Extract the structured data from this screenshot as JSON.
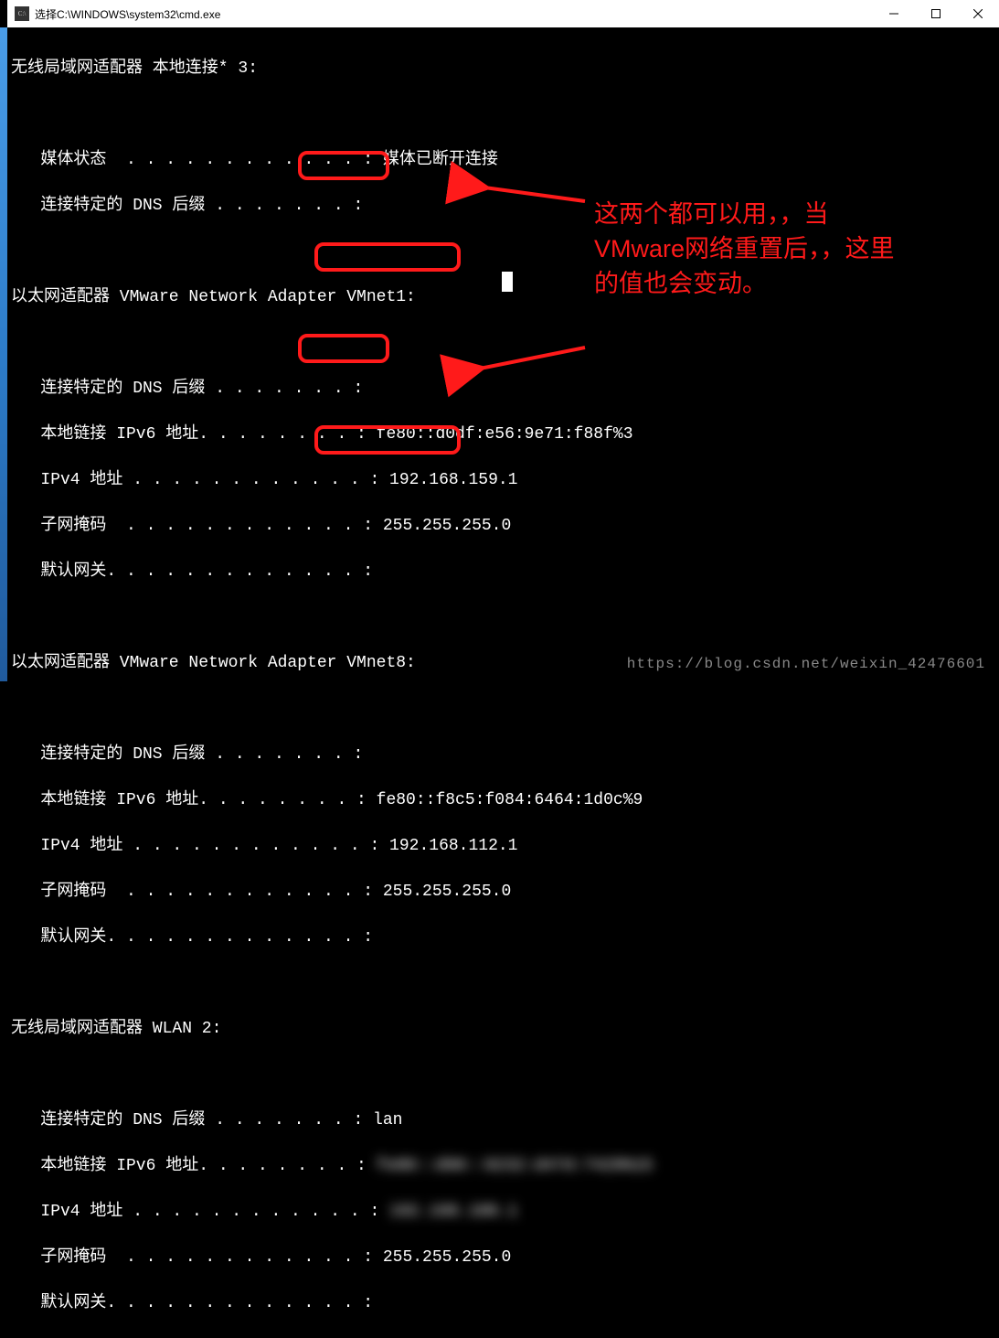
{
  "titlebar": {
    "title": "选择C:\\WINDOWS\\system32\\cmd.exe",
    "icon_label": "cmd"
  },
  "console": {
    "l1": "无线局域网适配器 本地连接* 3:",
    "l2": "",
    "l3": "   媒体状态  . . . . . . . . . . . . : 媒体已断开连接",
    "l4": "   连接特定的 DNS 后缀 . . . . . . . :",
    "l5": "",
    "l6": "以太网适配器 VMware Network Adapter VMnet1:",
    "l7": "",
    "l8": "   连接特定的 DNS 后缀 . . . . . . . :",
    "l9": "   本地链接 IPv6 地址. . . . . . . . : fe80::d0df:e56:9e71:f88f%3",
    "l10": "   IPv4 地址 . . . . . . . . . . . . : 192.168.159.1",
    "l11": "   子网掩码  . . . . . . . . . . . . : 255.255.255.0",
    "l12": "   默认网关. . . . . . . . . . . . . :",
    "l13": "",
    "l14": "以太网适配器 VMware Network Adapter VMnet8:",
    "l15": "",
    "l16": "   连接特定的 DNS 后缀 . . . . . . . :",
    "l17": "   本地链接 IPv6 地址. . . . . . . . : fe80::f8c5:f084:6464:1d0c%9",
    "l18": "   IPv4 地址 . . . . . . . . . . . . : 192.168.112.1",
    "l19": "   子网掩码  . . . . . . . . . . . . : 255.255.255.0",
    "l20": "   默认网关. . . . . . . . . . . . . :",
    "l21": "",
    "l22": "无线局域网适配器 WLAN 2:",
    "l23": "",
    "l24": "   连接特定的 DNS 后缀 . . . . . . . : lan",
    "l25a": "   本地链接 IPv6 地址. . . . . . . . : ",
    "l25b": "fe80::d90::9232:d47d:7429%15",
    "l26a": "   IPv4 地址 . . . . . . . . . . . . : ",
    "l26b": "192.168.100.1",
    "l27": "   子网掩码  . . . . . . . . . . . . : 255.255.255.0",
    "l28": "   默认网关. . . . . . . . . . . . . :"
  },
  "annotation": {
    "line1": "这两个都可以用，，当",
    "line2": "VMware网络重置后，，这里",
    "line3": "的值也会变动。"
  },
  "watermark": "https://blog.csdn.net/weixin_42476601"
}
